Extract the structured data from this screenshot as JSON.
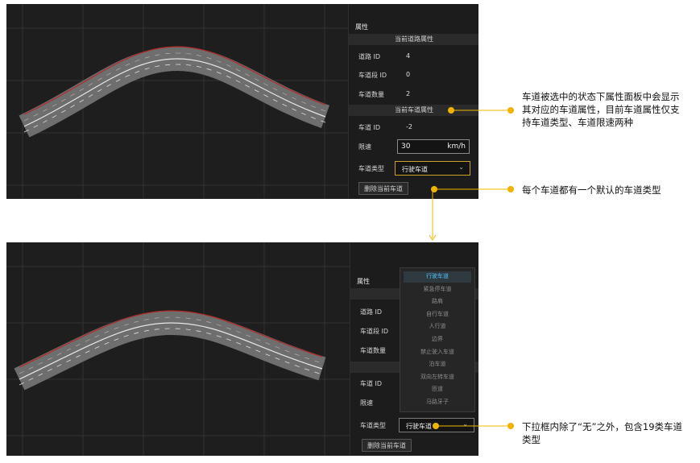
{
  "panel1": {
    "title": "属性",
    "road_section": "当前道路属性",
    "road_id_label": "道路 ID",
    "road_id_value": "4",
    "segment_id_label": "车道段 ID",
    "segment_id_value": "0",
    "lane_count_label": "车道数量",
    "lane_count_value": "2",
    "lane_section": "当前车道属性",
    "lane_id_label": "车道 ID",
    "lane_id_value": "-2",
    "speed_label": "限速",
    "speed_value": "30",
    "speed_unit": "km/h",
    "lane_type_label": "车道类型",
    "lane_type_value": "行驶车道",
    "delete_button": "删除当前车道"
  },
  "panel2": {
    "title": "属性",
    "road_id_label": "道路 ID",
    "segment_id_label": "车道段 ID",
    "lane_count_label": "车道数量",
    "lane_id_label": "车道 ID",
    "speed_label": "限速",
    "lane_type_label": "车道类型",
    "lane_type_value": "行驶车道",
    "delete_button": "删除当前车道",
    "dropdown_options": [
      "行驶车道",
      "紧急停车道",
      "路肩",
      "自行车道",
      "人行道",
      "边界",
      "禁止驶入车道",
      "泊车道",
      "双向左转车道",
      "匝道",
      "马路牙子"
    ]
  },
  "annotations": {
    "note1": "车道被选中的状态下属性面板中会显示其对应的车道属性，目前车道属性仅支持车道类型、车道限速两种",
    "note2": "每个车道都有一个默认的车道类型",
    "note3": "下拉框内除了“无”之外，包含19类车道类型"
  },
  "colors": {
    "accent": "#f0b400",
    "selected_option": "#4fc3f7",
    "lane_border": "#b02a2a"
  }
}
